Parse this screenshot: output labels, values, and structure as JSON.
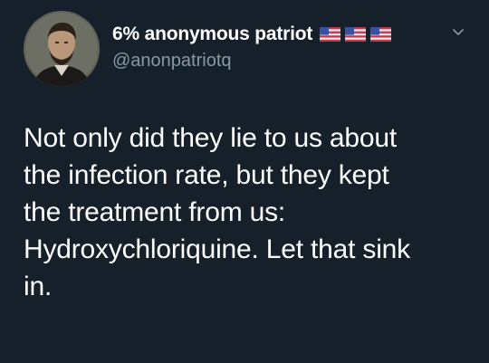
{
  "tweet": {
    "display_name": "6% anonymous patriot",
    "handle": "@anonpatriotq",
    "flag_icons": [
      "us-flag-icon",
      "us-flag-icon",
      "us-flag-icon"
    ],
    "caret_icon": "chevron-down-icon",
    "text_lines": [
      "Not only did they lie to us about",
      "the infection rate, but they kept",
      "the treatment from us:",
      "Hydroxychloriquine. Let that sink",
      "in."
    ]
  },
  "colors": {
    "background": "#15202b",
    "primary_text": "#ffffff",
    "secondary_text": "#8899a6"
  }
}
